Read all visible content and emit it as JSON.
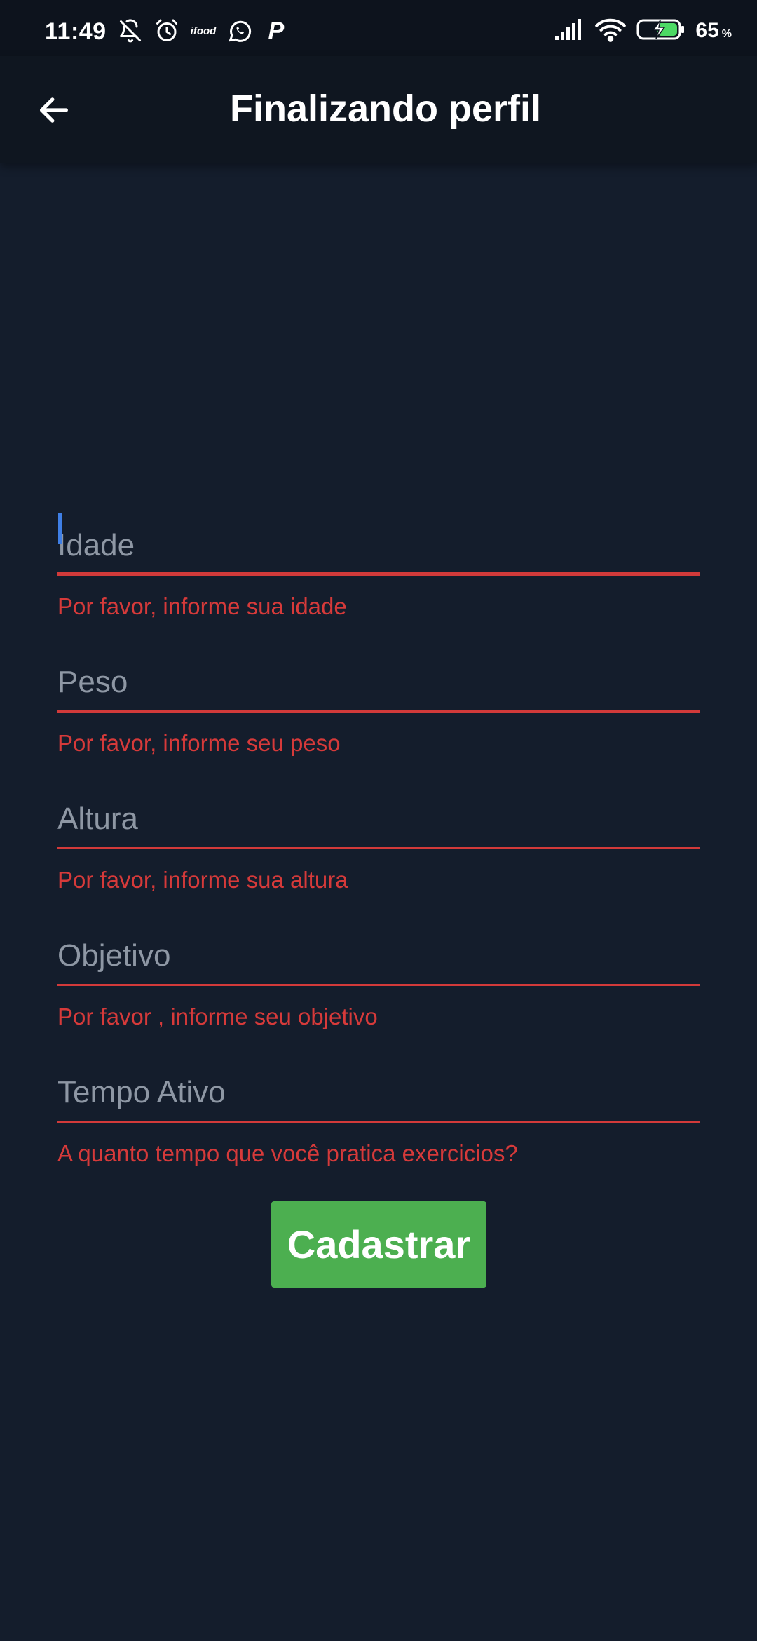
{
  "status_bar": {
    "time": "11:49",
    "battery_percent": "65",
    "battery_unit": "%",
    "notification_icons": [
      "mute-bell-icon",
      "alarm-icon",
      "ifood-icon",
      "whatsapp-icon",
      "p-icon"
    ],
    "ifood_label": "ifood",
    "p_label": "P"
  },
  "app_bar": {
    "title": "Finalizando perfil",
    "back_icon": "arrow-left-icon"
  },
  "form": {
    "fields": [
      {
        "placeholder": "Idade",
        "value": "",
        "error": "Por favor, informe sua idade",
        "focused": true
      },
      {
        "placeholder": "Peso",
        "value": "",
        "error": "Por favor, informe seu peso",
        "focused": false
      },
      {
        "placeholder": "Altura",
        "value": "",
        "error": "Por favor, informe sua altura",
        "focused": false
      },
      {
        "placeholder": "Objetivo",
        "value": "",
        "error": "Por favor , informe seu objetivo",
        "focused": false
      },
      {
        "placeholder": "Tempo Ativo",
        "value": "",
        "error": "A quanto tempo que você pratica exercicios?",
        "focused": false
      }
    ],
    "submit_label": "Cadastrar"
  },
  "colors": {
    "background": "#141d2c",
    "app_bar": "#0f1620",
    "error": "#d63a3a",
    "placeholder": "#8e97a4",
    "cursor": "#3f7fe6",
    "button": "#4caf50"
  }
}
